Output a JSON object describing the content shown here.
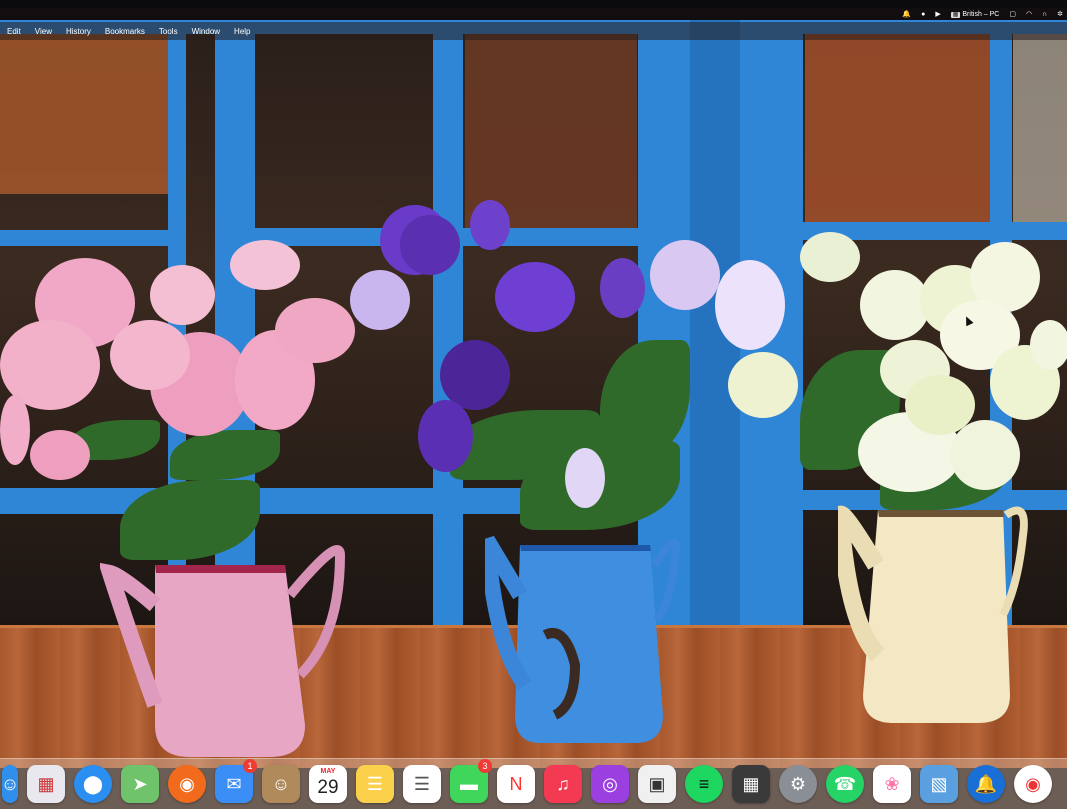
{
  "menubar": {
    "items": [
      "Edit",
      "View",
      "History",
      "Bookmarks",
      "Tools",
      "Window",
      "Help"
    ],
    "status": {
      "keyboard_layout": "British – PC"
    }
  },
  "dock": {
    "apps": [
      {
        "name": "finder-icon",
        "color": "#2f8fea"
      },
      {
        "name": "launchpad-icon",
        "color": "#e8e8ee"
      },
      {
        "name": "safari-icon",
        "color": "#2a8ff0"
      },
      {
        "name": "maps-icon",
        "color": "#6ec36b"
      },
      {
        "name": "firefox-icon",
        "color": "#f26b1d"
      },
      {
        "name": "mail-icon",
        "color": "#3a8ef6",
        "badge": "1"
      },
      {
        "name": "contacts-icon",
        "color": "#b08a5a"
      },
      {
        "name": "calendar-icon",
        "color": "#ffffff",
        "month": "MAY",
        "day": "29"
      },
      {
        "name": "notes-icon",
        "color": "#fbd14b"
      },
      {
        "name": "reminders-icon",
        "color": "#ffffff"
      },
      {
        "name": "messages-icon",
        "color": "#3fd65b",
        "badge": "3"
      },
      {
        "name": "news-icon",
        "color": "#ffffff"
      },
      {
        "name": "music-icon",
        "color": "#f43a52"
      },
      {
        "name": "podcasts-icon",
        "color": "#9b3fe0"
      },
      {
        "name": "screenshot-icon",
        "color": "#f0f0f0"
      },
      {
        "name": "spotify-icon",
        "color": "#1ed760"
      },
      {
        "name": "calculator-icon",
        "color": "#3a3a3a"
      },
      {
        "name": "system-preferences-icon",
        "color": "#8a8f96"
      },
      {
        "name": "whatsapp-icon",
        "color": "#25d366"
      },
      {
        "name": "photos-icon",
        "color": "#ffffff"
      },
      {
        "name": "preview-icon",
        "color": "#5aa0e0"
      },
      {
        "name": "notification-icon",
        "color": "#1a6fd6"
      },
      {
        "name": "chrome-icon",
        "color": "#ffffff"
      }
    ]
  }
}
